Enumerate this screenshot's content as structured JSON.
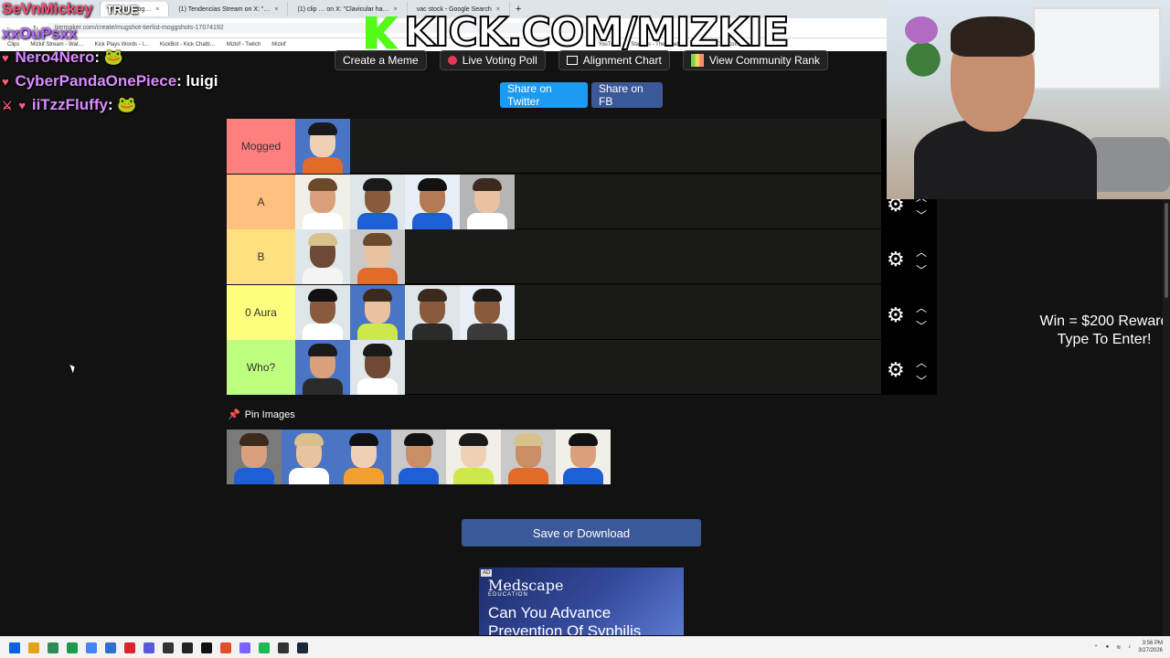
{
  "browser": {
    "tabs": [
      {
        "label": "Tierlist (Mog…",
        "active": true
      },
      {
        "label": "(1) Tendencias Stream on X: \"…",
        "active": false
      },
      {
        "label": "(1) clip … on X: \"Clavicular ha…",
        "active": false
      },
      {
        "label": "vac stock - Google Search",
        "active": false
      }
    ],
    "url": "tiermaker.com/create/mugshot-tierlist-moggshots-17074192",
    "bookmarks": [
      "Clips",
      "Mizkif Stream - Wat…",
      "Kick Plays Words - I…",
      "KickBot - Kick Chatb…",
      "Mizkif - Twitch",
      "Mizkif",
      "YouTube",
      "Stakeus - The Leadi…",
      "KickBot Clip Comm…"
    ]
  },
  "chat": [
    {
      "user": "SeVnMickey",
      "msg": "TRUE",
      "emote": ""
    },
    {
      "user": "xxOuPsxx",
      "msg": "",
      "emote": ""
    },
    {
      "user": "Nero4Nero",
      "msg": "",
      "emote": "🐸"
    },
    {
      "user": "CyberPandaOnePiece",
      "msg": "luigi",
      "emote": ""
    },
    {
      "user": "iiTzzFluffy",
      "msg": "",
      "emote": "🐸"
    }
  ],
  "overlay": {
    "kick_text": "KICK.COM/MIZKIE",
    "promo_line1": "Win = $200 Reward",
    "promo_line2": "Type To Enter!"
  },
  "nav": {
    "create_meme": "Create a Meme",
    "live_voting": "Live Voting Poll",
    "alignment": "Alignment Chart",
    "community_rank": "View Community Rank"
  },
  "share": {
    "twitter": "Share on Twitter",
    "facebook": "Share on FB"
  },
  "tiers": [
    {
      "label": "Mogged",
      "color": "#ff7f7f",
      "count": 1
    },
    {
      "label": "A",
      "color": "#ffbf7f",
      "count": 4
    },
    {
      "label": "B",
      "color": "#ffdf7f",
      "count": 2
    },
    {
      "label": "0 Aura",
      "color": "#ffff7f",
      "count": 4
    },
    {
      "label": "Who?",
      "color": "#bfff7f",
      "count": 2
    }
  ],
  "pin": {
    "title": "Pin Images",
    "count": 7
  },
  "save_label": "Save or Download",
  "ad": {
    "tag": "AD",
    "brand": "Medscape",
    "sub": "EDUCATION",
    "headline1": "Can You Advance",
    "headline2": "Prevention Of Syphilis"
  },
  "taskbar": {
    "time": "3:56 PM",
    "date": "3/27/2026"
  }
}
